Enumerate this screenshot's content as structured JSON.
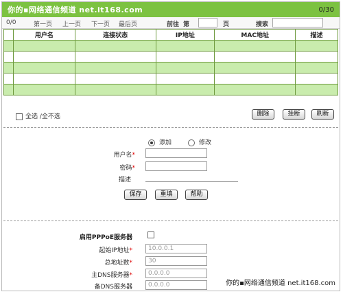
{
  "header": {
    "title": "你的▪网络通信频道 net.it168.com",
    "page_count": "0/30"
  },
  "pager": {
    "position": "0/0",
    "first": "第一页",
    "prev": "上一页",
    "next": "下一页",
    "last": "最后页",
    "goto_prefix": "前往",
    "goto_mid": "第",
    "goto_suffix": "页",
    "search_label": "搜索",
    "page_input_value": "",
    "search_input_value": ""
  },
  "table": {
    "columns": [
      "用户名",
      "连接状态",
      "IP地址",
      "MAC地址",
      "描述"
    ],
    "rows": [
      [
        "",
        "",
        "",
        "",
        ""
      ],
      [
        "",
        "",
        "",
        "",
        ""
      ],
      [
        "",
        "",
        "",
        "",
        ""
      ],
      [
        "",
        "",
        "",
        "",
        ""
      ],
      [
        "",
        "",
        "",
        "",
        ""
      ]
    ]
  },
  "selection": {
    "select_all_label": "全选 /全不选"
  },
  "actions": {
    "delete": "删除",
    "hangup": "挂断",
    "refresh": "刷新"
  },
  "mode": {
    "add_label": "添加",
    "edit_label": "修改",
    "selected": "添加"
  },
  "form": {
    "username_label": "用户名",
    "password_label": "密码",
    "description_label": "描述",
    "required_mark": "*"
  },
  "form_buttons": {
    "save": "保存",
    "reset": "重填",
    "help": "帮助"
  },
  "pppoe": {
    "enable_label": "启用PPPoE服务器",
    "start_ip_label": "起始IP地址",
    "start_ip_value": "10.0.0.1",
    "total_addr_label": "总地址数",
    "total_addr_value": "30",
    "primary_dns_label": "主DNS服务器",
    "primary_dns_value": "0.0.0.0",
    "secondary_dns_label": "备DNS服务器",
    "secondary_dns_value": "0.0.0.0"
  },
  "watermark": {
    "text": "你的▪网络通信频道 net.it168.com"
  },
  "colors": {
    "header_green": "#7cc241",
    "row_green": "#c9ecad",
    "grid_green": "#6e9a3e"
  }
}
